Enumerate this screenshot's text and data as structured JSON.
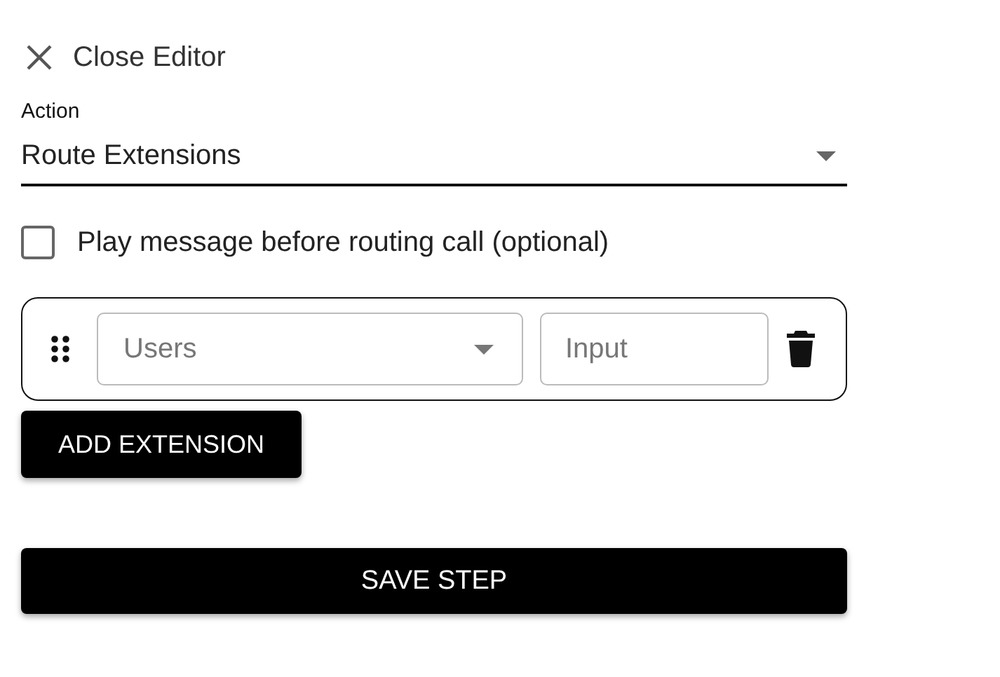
{
  "close_button": {
    "label": "Close Editor"
  },
  "action_field": {
    "label": "Action",
    "value": "Route Extensions"
  },
  "play_message": {
    "label": "Play message before routing call (optional)",
    "checked": false
  },
  "extensions": [
    {
      "type_select": {
        "placeholder": "Users"
      },
      "input": {
        "placeholder": "Input"
      }
    }
  ],
  "add_button": {
    "label": "ADD EXTENSION"
  },
  "save_button": {
    "label": "SAVE STEP"
  }
}
